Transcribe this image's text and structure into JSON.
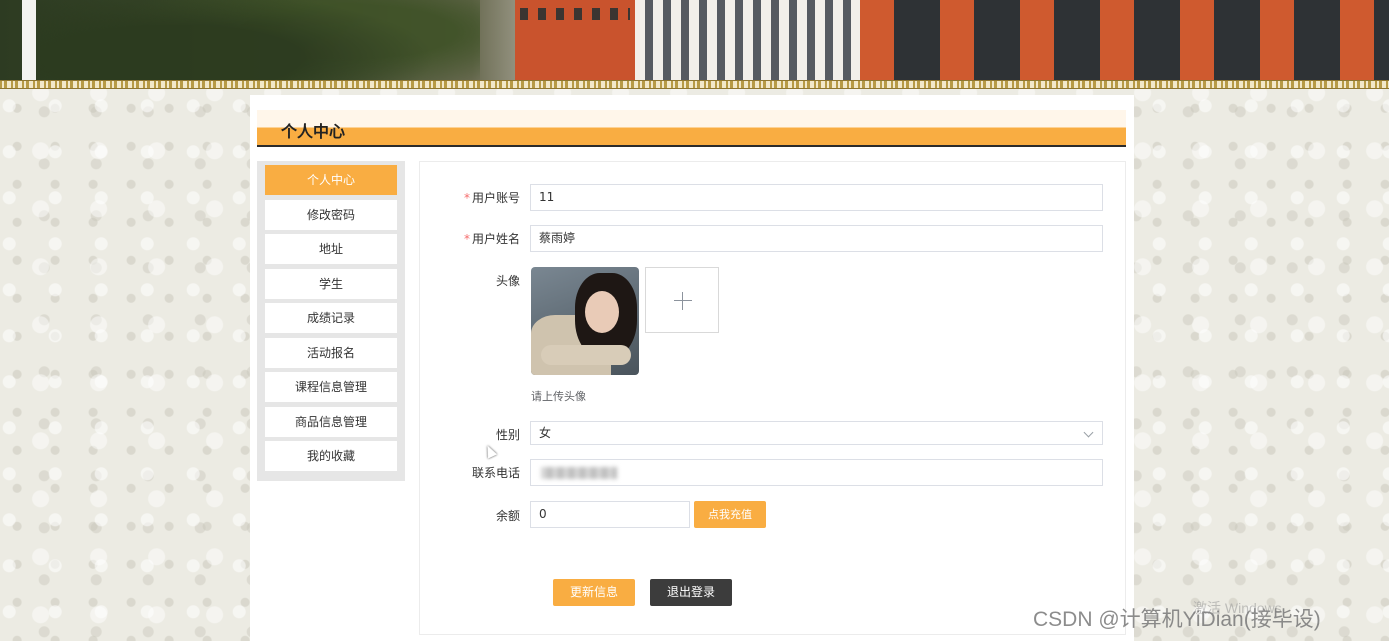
{
  "header": {
    "page_title": "个人中心"
  },
  "sidebar": {
    "items": [
      {
        "label": "个人中心",
        "active": true
      },
      {
        "label": "修改密码",
        "active": false
      },
      {
        "label": "地址",
        "active": false
      },
      {
        "label": "学生",
        "active": false
      },
      {
        "label": "成绩记录",
        "active": false
      },
      {
        "label": "活动报名",
        "active": false
      },
      {
        "label": "课程信息管理",
        "active": false
      },
      {
        "label": "商品信息管理",
        "active": false
      },
      {
        "label": "我的收藏",
        "active": false
      }
    ]
  },
  "form": {
    "required_mark": "*",
    "account_label": "用户账号",
    "account_value": "11",
    "name_label": "用户姓名",
    "name_value": "蔡雨婷",
    "avatar_label": "头像",
    "avatar_hint": "请上传头像",
    "gender_label": "性别",
    "gender_value": "女",
    "phone_label": "联系电话",
    "balance_label": "余额",
    "balance_value": "0",
    "recharge_button": "点我充值",
    "update_button": "更新信息",
    "logout_button": "退出登录"
  },
  "overlay": {
    "windows_activate": "激活 Windows",
    "watermark": "CSDN @计算机YiDian(接毕设)"
  },
  "colors": {
    "accent": "#f9ad42",
    "dark_button": "#3c3c3c",
    "required": "#f56c6c"
  }
}
